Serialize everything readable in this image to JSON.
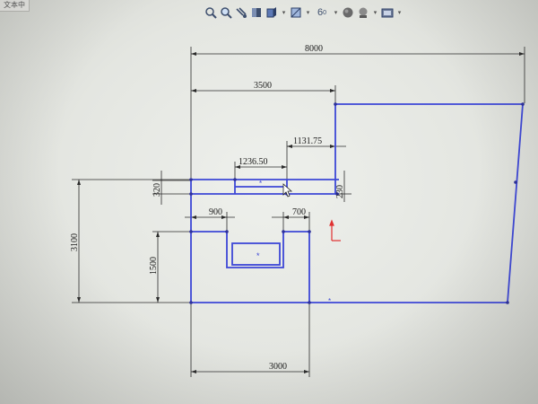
{
  "tab": {
    "label": "文本中"
  },
  "toolbar": {
    "icons": [
      "zoom-fit-icon",
      "zoom-area-icon",
      "previous-view-icon",
      "section-view-icon",
      "view-orientation-icon",
      "display-style-icon",
      "hide-show-icon",
      "appearance-icon",
      "scene-icon",
      "view-settings-icon"
    ],
    "view_settings_glyph": "6",
    "view_settings_sub": "0"
  },
  "dimensions": {
    "overall_width": "8000",
    "left_width": "3500",
    "right_offset": "1131.75",
    "mid_offset": "1236.50",
    "slot_height": "320",
    "right_small": "230",
    "notch_left": "900",
    "notch_right": "700",
    "total_height": "3100",
    "lower_height": "1500",
    "bottom_width": "3000"
  },
  "colors": {
    "sketch_line": "#3d47d6",
    "dimension_line": "#2b2b2b",
    "origin_arrow": "#e03030"
  }
}
